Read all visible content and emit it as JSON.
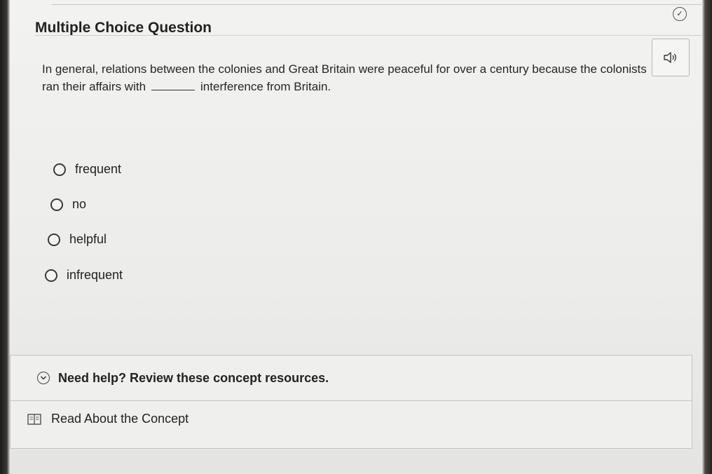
{
  "question": {
    "title": "Multiple Choice Question",
    "text_before": "In general, relations between the colonies and Great Britain were peaceful for over a century because the colonists ran their affairs with",
    "text_after": "interference from Britain."
  },
  "options": [
    {
      "label": "frequent"
    },
    {
      "label": "no"
    },
    {
      "label": "helpful"
    },
    {
      "label": "infrequent"
    }
  ],
  "help": {
    "title": "Need help? Review these concept resources.",
    "resource_label": "Read About the Concept"
  },
  "icons": {
    "audio": "speaker-icon",
    "progress": "check-circle-icon",
    "expand": "chevron-down-icon",
    "resource": "book-icon"
  }
}
